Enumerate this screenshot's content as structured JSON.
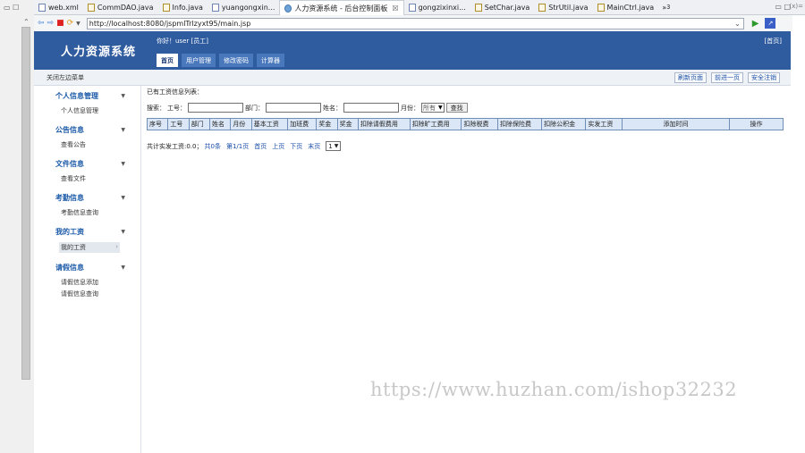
{
  "ide": {
    "tabs": [
      {
        "label": "web.xml",
        "icon": "xml-file-icon"
      },
      {
        "label": "CommDAO.java",
        "icon": "java-file-icon"
      },
      {
        "label": "Info.java",
        "icon": "java-file-icon"
      },
      {
        "label": "yuangongxin...",
        "icon": "jsp-file-icon"
      },
      {
        "label": "人力资源系统 - 后台控制面板",
        "icon": "globe-icon",
        "active": true
      },
      {
        "label": "gongzixinxi...",
        "icon": "jsp-file-icon"
      },
      {
        "label": "SetChar.java",
        "icon": "java-file-icon"
      },
      {
        "label": "StrUtil.java",
        "icon": "java-file-icon"
      },
      {
        "label": "MainCtrl.java",
        "icon": "java-file-icon"
      }
    ],
    "more_tabs": "»",
    "more_count": "3",
    "close_glyph": "☒",
    "win_min": "▭",
    "win_max": "□",
    "side_label": "(x)="
  },
  "browser": {
    "url": "http://localhost:8080/jspmlTrlzyxt95/main.jsp"
  },
  "app": {
    "logo": "人力资源系统",
    "greeting": "你好！user [员工]",
    "home_link": "[首页]",
    "nav": [
      "首页",
      "用户管理",
      "修改密码",
      "计算器"
    ],
    "close_menu": "关闭左边菜单",
    "sub_buttons": [
      "刷新页面",
      "前进一页",
      "安全注销"
    ]
  },
  "sidebar": {
    "sections": [
      {
        "title": "个人信息管理",
        "items": [
          "个人信息管理"
        ]
      },
      {
        "title": "公告信息",
        "items": [
          "查看公告"
        ]
      },
      {
        "title": "文件信息",
        "items": [
          "查看文件"
        ]
      },
      {
        "title": "考勤信息",
        "items": [
          "考勤信息查询"
        ]
      },
      {
        "title": "我的工资",
        "items": [
          "我的工资"
        ]
      },
      {
        "title": "请假信息",
        "items": [
          "请假信息添加",
          "请假信息查询"
        ]
      }
    ]
  },
  "main": {
    "title": "已有工资信息列表：",
    "search": {
      "label": "搜索：",
      "field1": "工号：",
      "field2": "部门：",
      "field3": "姓名：",
      "field4": "月份：",
      "month_value": "所有",
      "button": "查找"
    },
    "columns": [
      "序号",
      "工号",
      "部门",
      "姓名",
      "月份",
      "基本工资",
      "加班费",
      "奖金",
      "奖金",
      "扣除请假费用",
      "扣除旷工费用",
      "扣除税费",
      "扣除保险费",
      "扣除公积金",
      "实发工资",
      "添加时间",
      "操作"
    ],
    "pager": {
      "summary": "共计实发工资:0.0；",
      "count": "共0条",
      "page": "第1/1页",
      "first": "首页",
      "prev": "上页",
      "next": "下页",
      "last": "末页",
      "select": "1"
    }
  },
  "watermark": "https://www.huzhan.com/ishop32232"
}
